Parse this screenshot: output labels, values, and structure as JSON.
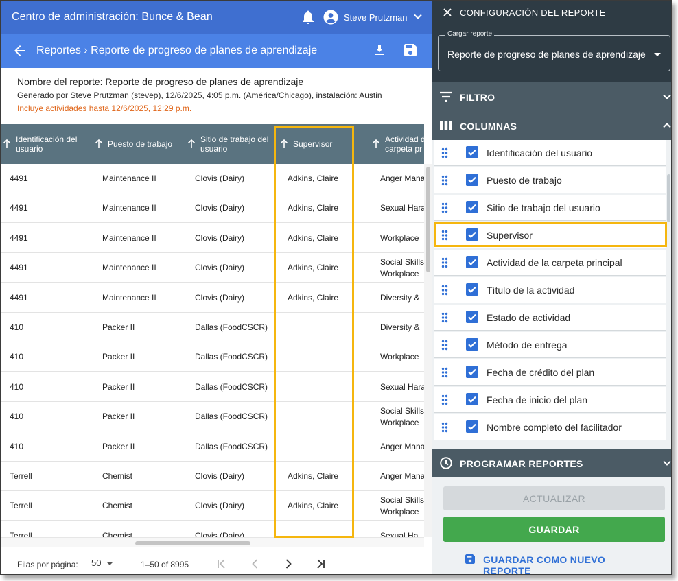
{
  "header": {
    "title": "Centro de administración: Bunce & Bean",
    "user": "Steve Prutzman"
  },
  "subheader": {
    "crumb": "Reportes › Reporte de progreso de planes de aprendizaje"
  },
  "report": {
    "name": "Nombre del reporte: Reporte de progreso de planes de aprendizaje",
    "generated": "Generado por Steve Prutzman (stevep), 12/6/2025, 4:05 p.m. (América/Chicago), instalación: Austin",
    "includes": "Incluye actividades hasta 12/6/2025, 12:29 p.m."
  },
  "table": {
    "headers": [
      "Identificación del usuario",
      "Puesto de trabajo",
      "Sitio de trabajo del usuario",
      "Supervisor",
      "Actividad de la carpeta pr"
    ],
    "rows": [
      [
        "4491",
        "Maintenance II",
        "Clovis (Dairy)",
        "Adkins, Claire",
        "Anger Mana"
      ],
      [
        "4491",
        "Maintenance II",
        "Clovis (Dairy)",
        "Adkins, Claire",
        "Sexual Hara"
      ],
      [
        "4491",
        "Maintenance II",
        "Clovis (Dairy)",
        "Adkins, Claire",
        "Workplace"
      ],
      [
        "4491",
        "Maintenance II",
        "Clovis (Dairy)",
        "Adkins, Claire",
        "Social Skills\nWorkplace"
      ],
      [
        "4491",
        "Maintenance II",
        "Clovis (Dairy)",
        "Adkins, Claire",
        "Diversity &"
      ],
      [
        "410",
        "Packer II",
        "Dallas (FoodCSCR)",
        "",
        "Diversity &"
      ],
      [
        "410",
        "Packer II",
        "Dallas (FoodCSCR)",
        "",
        "Workplace"
      ],
      [
        "410",
        "Packer II",
        "Dallas (FoodCSCR)",
        "",
        "Sexual Hara"
      ],
      [
        "410",
        "Packer II",
        "Dallas (FoodCSCR)",
        "",
        "Social Skills\nWorkplace"
      ],
      [
        "410",
        "Packer II",
        "Dallas (FoodCSCR)",
        "",
        "Anger Mana"
      ],
      [
        "Terrell",
        "Chemist",
        "Clovis (Dairy)",
        "Adkins, Claire",
        "Anger Mana"
      ],
      [
        "Terrell",
        "Chemist",
        "Clovis (Dairy)",
        "Adkins, Claire",
        "Social Skills\nWorkplace"
      ],
      [
        "Terrell",
        "Chemist",
        "Clovis (Dairy)",
        "",
        "Sexual Ha"
      ]
    ]
  },
  "pager": {
    "rows_per_page_label": "Filas por página:",
    "rows_per_page": "50",
    "range": "1–50 of 8995"
  },
  "panel": {
    "title": "CONFIGURACIÓN DEL REPORTE",
    "load_label": "Cargar reporte",
    "load_value": "Reporte de progreso de planes de aprendizaje",
    "filter": "FILTRO",
    "columns": "COLUMNAS",
    "column_items": [
      "Identificación del usuario",
      "Puesto de trabajo",
      "Sitio de trabajo del usuario",
      "Supervisor",
      "Actividad de la carpeta principal",
      "Título de la actividad",
      "Estado de actividad",
      "Método de entrega",
      "Fecha de crédito del plan",
      "Fecha de inicio del plan",
      "Nombre completo del facilitador"
    ],
    "schedule": "PROGRAMAR REPORTES",
    "update_button": "ACTUALIZAR",
    "save_button": "GUARDAR",
    "save_new_button": "GUARDAR COMO NUEVO REPORTE"
  },
  "colors": {
    "topbar": "#3f6fd0",
    "subbar": "#4b82e6",
    "table_header": "#5a7380",
    "highlight": "#f5b60f",
    "panel": "#2e3b44",
    "accent": "#2f6fd6",
    "save": "#43a84d",
    "warning_text": "#e0661a"
  }
}
